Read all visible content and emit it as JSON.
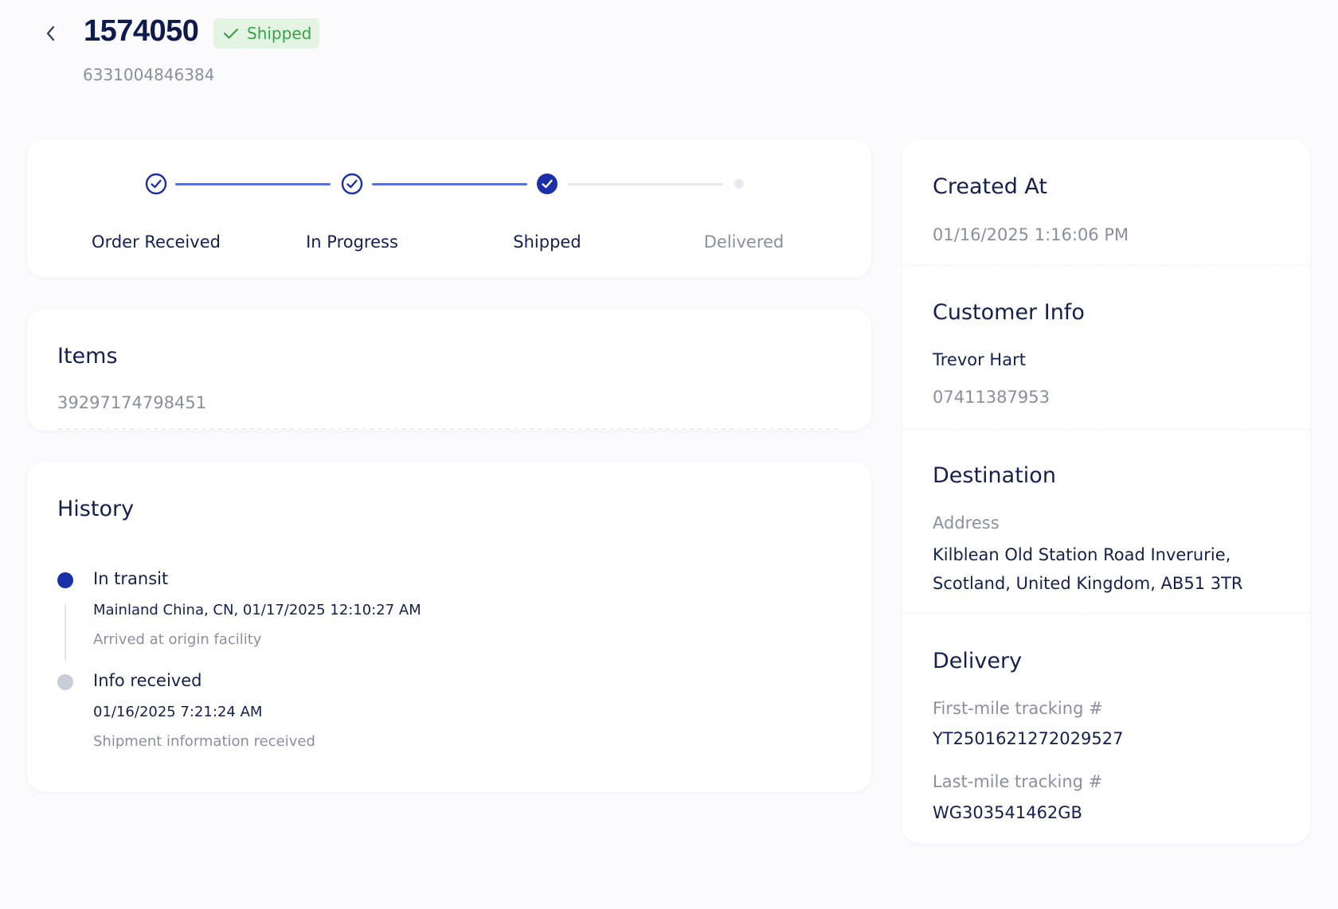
{
  "header": {
    "order_number": "1574050",
    "status_label": "Shipped",
    "reference": "6331004846384"
  },
  "progress": {
    "steps": [
      {
        "label": "Order Received",
        "state": "done"
      },
      {
        "label": "In Progress",
        "state": "done"
      },
      {
        "label": "Shipped",
        "state": "current"
      },
      {
        "label": "Delivered",
        "state": "pending"
      }
    ]
  },
  "items": {
    "title": "Items",
    "values": [
      "39297174798451"
    ]
  },
  "history": {
    "title": "History",
    "events": [
      {
        "status": "In transit",
        "location_time": "Mainland China, CN, 01/17/2025 12:10:27 AM",
        "description": "Arrived at origin facility"
      },
      {
        "status": "Info received",
        "location_time": "01/16/2025 7:21:24 AM",
        "description": "Shipment information received"
      }
    ]
  },
  "sidebar": {
    "created_at": {
      "title": "Created At",
      "value": "01/16/2025 1:16:06 PM"
    },
    "customer": {
      "title": "Customer Info",
      "name": "Trevor Hart",
      "phone": "07411387953"
    },
    "destination": {
      "title": "Destination",
      "address_label": "Address",
      "address_line1": "Kilblean Old Station Road Inverurie,",
      "address_line2": "Scotland, United Kingdom, AB51 3TR"
    },
    "delivery": {
      "title": "Delivery",
      "first_mile_label": "First-mile tracking #",
      "first_mile_value": "YT2501621272029527",
      "last_mile_label": "Last-mile tracking #",
      "last_mile_value": "WG303541462GB"
    }
  },
  "colors": {
    "accent": "#1a2fa8",
    "accent_line": "#5b6fd6",
    "pending_line": "#e8e9ee",
    "success_bg": "#e3f4e3",
    "success_text": "#3aa04a",
    "heading": "#14204f",
    "muted": "#8a8fa0",
    "page_bg": "#fbfbfe"
  },
  "icons": {
    "back": "chevron-left-icon",
    "badge": "check-icon",
    "step_done": "circle-check-icon",
    "step_current": "filled-circle-check-icon",
    "step_pending": "dot-icon"
  }
}
